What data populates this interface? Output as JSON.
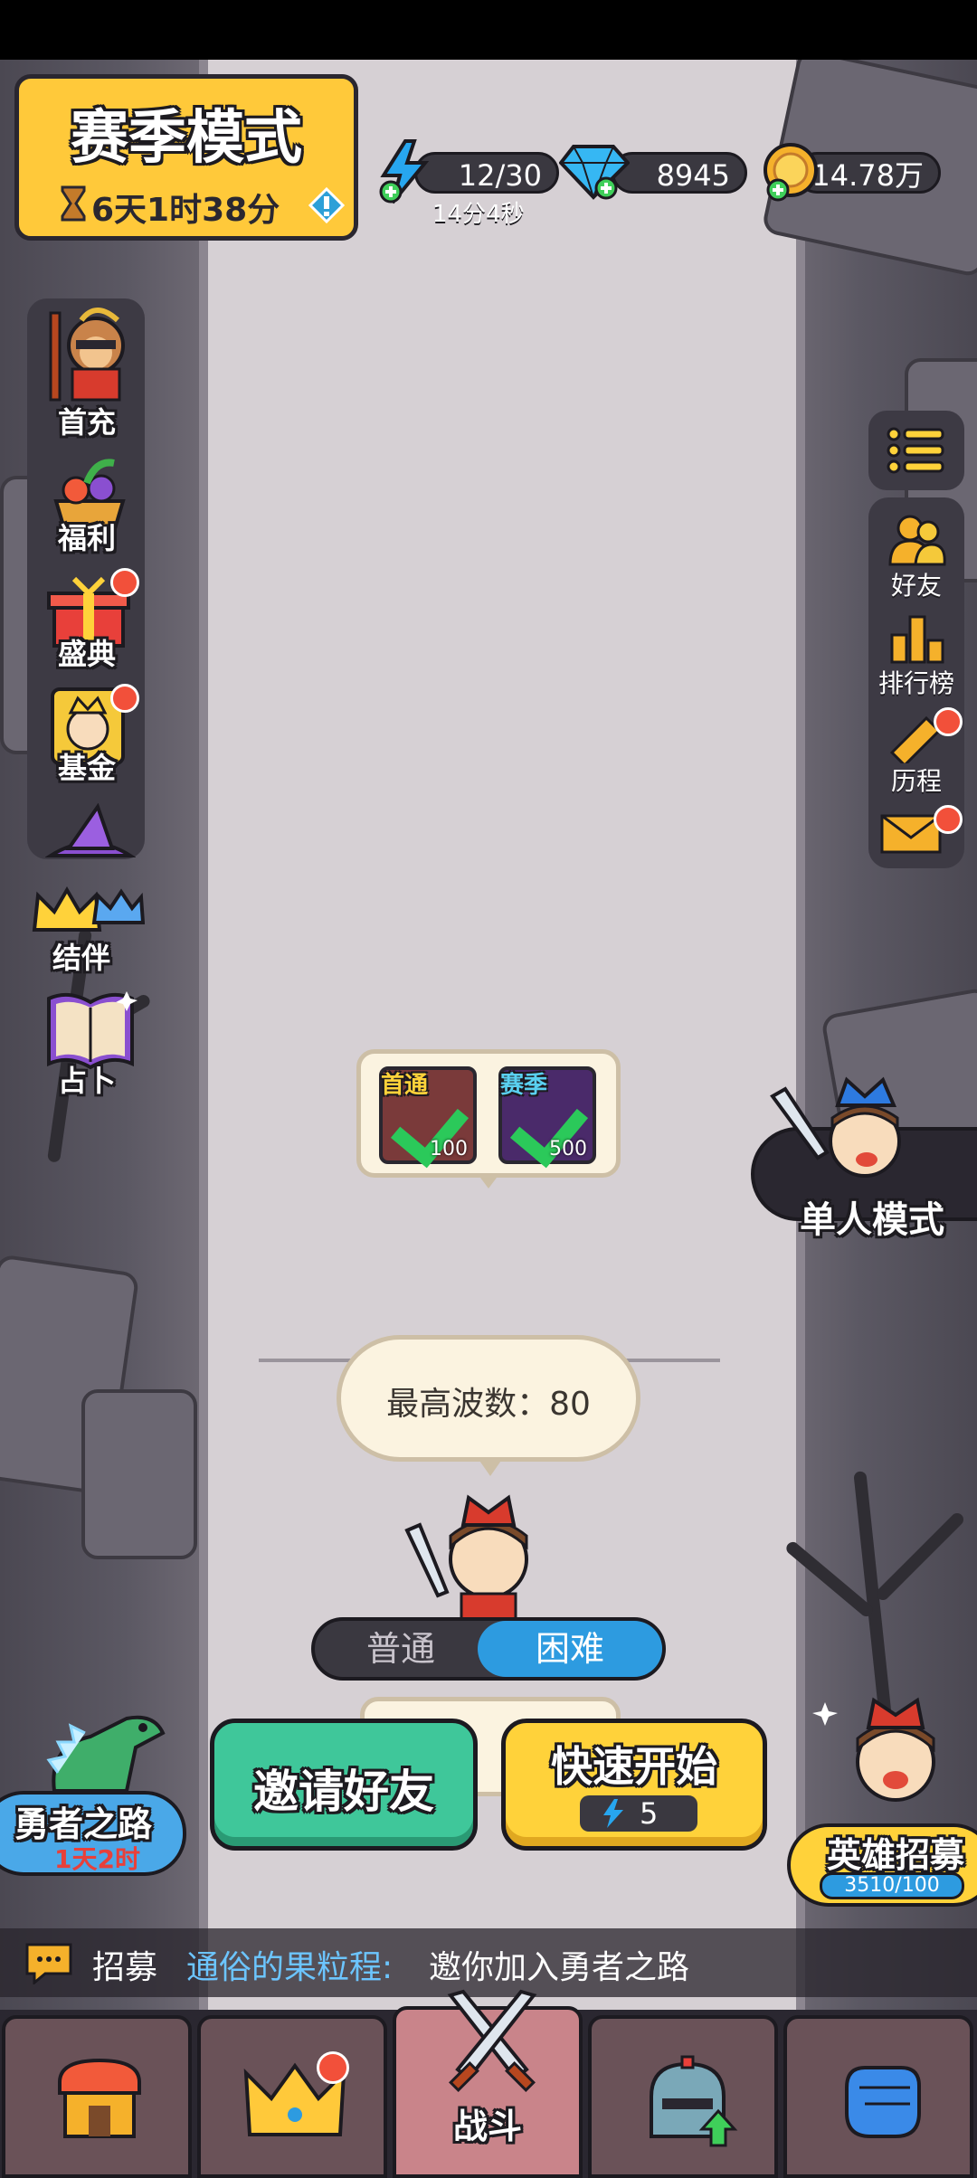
{
  "season": {
    "title": "赛季模式",
    "timer": "6天1时38分"
  },
  "resources": {
    "energy": {
      "value": "12/30",
      "timer": "14分4秒"
    },
    "diamond": {
      "value": "8945"
    },
    "coin": {
      "value": "14.78万"
    }
  },
  "left_menu": {
    "first_recharge": "首充",
    "welfare": "福利",
    "festival": "盛典",
    "fund": "基金",
    "partner": "结伴",
    "divination": "占卜"
  },
  "right_menu": {
    "friends": "好友",
    "ranking": "排行榜",
    "history": "历程"
  },
  "single_mode": "单人模式",
  "rewards": [
    {
      "tag": "首通",
      "amount": "100"
    },
    {
      "tag": "赛季",
      "amount": "500"
    }
  ],
  "max_wave": "最高波数：80",
  "difficulty": {
    "normal": "普通",
    "hard": "困难",
    "selected": "hard"
  },
  "buttons": {
    "invite": "邀请好友",
    "quick_start": "快速开始",
    "quick_start_cost": "5"
  },
  "hero_road": {
    "title": "勇者之路",
    "timer": "1天2时"
  },
  "hero_recruit": {
    "title": "英雄招募",
    "progress": "3510/100"
  },
  "chat": {
    "channel": "招募",
    "sender": "通俗的果粒程:",
    "text": "邀你加入勇者之路"
  },
  "tabs": {
    "battle": "战斗",
    "active": "battle"
  },
  "colors": {
    "gold": "#ffc93a",
    "green_btn": "#3fc79a",
    "blue_sel": "#2d9be0",
    "badge": "#f2503a"
  }
}
